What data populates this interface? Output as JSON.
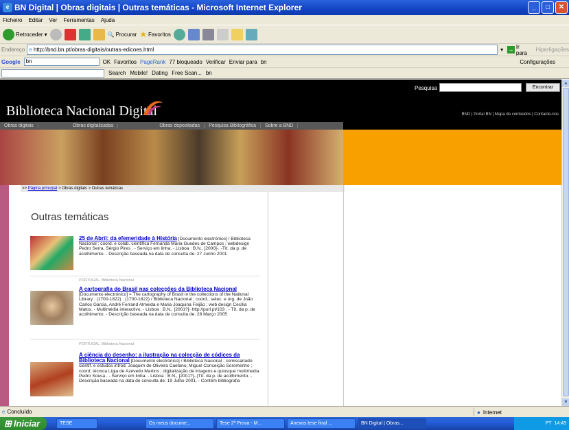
{
  "window": {
    "title": "BN Digital | Obras digitais | Outras temáticas - Microsoft Internet Explorer"
  },
  "menu": [
    "Ficheiro",
    "Editar",
    "Ver",
    "Ferramentas",
    "Ajuda"
  ],
  "toolbar": {
    "back": "Retroceder",
    "search": "Procurar",
    "favorites": "Favoritos"
  },
  "address": {
    "label": "Endereço",
    "url": "http://bnd.bn.pt/obras-digitais/outras-edicoes.html",
    "go": "Ir para",
    "links": "Hiperligações"
  },
  "google_bar": {
    "brand": "Google",
    "search_value": "bn",
    "ok": "OK",
    "favorites": "Favoritos",
    "pagerank": "PageRank",
    "blocked": "77 bloqueado",
    "check": "Verificar",
    "send": "Enviar para",
    "bn": "bn",
    "settings": "Configurações"
  },
  "second_bar": {
    "search": "Search",
    "mobile": "Mobile!",
    "dating": "Dating",
    "freescan": "Free Scan...",
    "bn": "bn"
  },
  "site": {
    "title": "Biblioteca Nacional Digital",
    "search_label": "Pesquisa",
    "search_button": "Encontrar",
    "top_links": "BND | Portal BN | Mapa de conteúdos | Contacte-nos",
    "nav": [
      "Obras digitais",
      "Obras digitalizadas",
      "Obras depositadas",
      "Pesquisa Bibliográfica",
      "Sobre a BND"
    ],
    "breadcrumb": {
      "prefix": ">>",
      "home": "Página principal",
      "rest": "> Obras digitais > Outras temáticas"
    },
    "page_title": "Outras temáticas",
    "items": [
      {
        "title": "25 de Abril: da efemeridade à História",
        "desc": " [Documento electrónico] / Biblioteca Nacional ; coord. e colab. científica Fernanda Maria Guedes de Campos ; webdesign Pedro Serra, Sérgio Pires . - Serviço em linha. - Lisboa : B.N., [2000]-. -Tít. da p. de acolhimento. - Descrição baseada na data de consulta de: 27 Junho 2001",
        "source": "PORTUGAL. Biblioteca Nacional"
      },
      {
        "title": "A cartografia do Brasil nas colecções da Biblioteca Nacional",
        "desc": " [Documento electrónico] = The cartography of Brasil in the collections of the National Library : (1700-1822) : (1700-1822) / Biblioteca Nacional ; coord., selec. e org. de João Carlos Garcia, André Ferrand Almeida e Maria Joaquina Feijão ; web design Cecília Matos. - Multimédia interactivo. - Lisboa : B.N., [2001?]- http://purl.pt/103 . - Tít. da p. de acolhimento. - Descrição baseada na data de consulta de: 28 Março 2005",
        "source": "PORTUGAL. Biblioteca Nacional"
      },
      {
        "title": "A ciência do desenho: a ilustração na colecção de códices da Biblioteca Nacional",
        "desc": " [Documento electrónico] / Biblioteca Nacional ; comissariado cientif. e estudos introd. Joaquim de Oliveira Caetano, Miguel Conceição Soromenho ; coord. técnica Lígia de Azevedo Martins ; digitalização de imagens e quiosque multimedia Pedro Sousa . - Serviço em linha. - Lisboa : B.N., [2001?]-.)Tít. da p. de acolhimento. - Descrição baseada na data de consulta de: 19 Julho 2001. - Contém bibliografia",
        "source": ""
      }
    ]
  },
  "status": {
    "text": "Concluído",
    "zone": "Internet"
  },
  "taskbar": {
    "start": "Iniciar",
    "tasks": [
      "TESE",
      "Os meus docume...",
      "Tese 2ª Prova - M...",
      "Anexos tese final ...",
      "BN Digital | Obras..."
    ],
    "clock": "14:49",
    "lang": "PT"
  }
}
